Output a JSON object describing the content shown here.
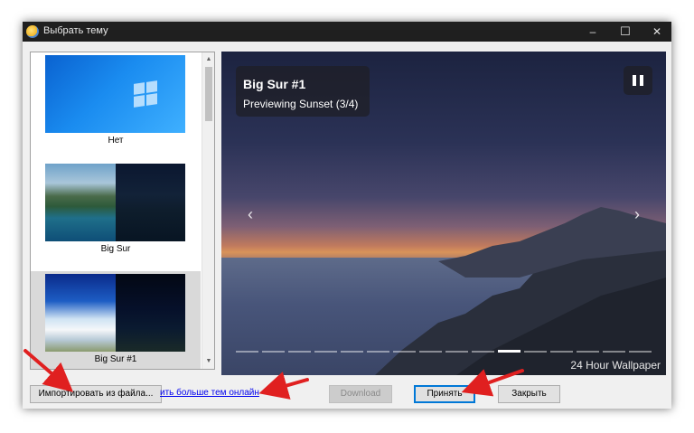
{
  "window": {
    "title": "Выбрать тему",
    "controls": {
      "minimize": "–",
      "maximize": "☐",
      "close": "✕"
    }
  },
  "theme_list": {
    "items": [
      {
        "label": "Нет",
        "selected": false
      },
      {
        "label": "Big Sur",
        "selected": false
      },
      {
        "label": "Big Sur #1",
        "selected": true
      }
    ],
    "scroll_up": "▲",
    "scroll_down": "▼"
  },
  "preview": {
    "title": "Big Sur #1",
    "subtitle": "Previewing Sunset (3/4)",
    "caption": "24 Hour Wallpaper",
    "prev_arrow": "‹",
    "next_arrow": "›",
    "segments_total": 16,
    "segments_active_index": 10
  },
  "footer": {
    "import_button": "Импортировать из файла...",
    "online_link": "ить больше тем онлайн",
    "download_button": "Download",
    "accept_button": "Принять",
    "close_button": "Закрыть"
  },
  "colors": {
    "annotation_arrow": "#e02020",
    "accept_border": "#0078d7",
    "link": "#0000ee"
  }
}
